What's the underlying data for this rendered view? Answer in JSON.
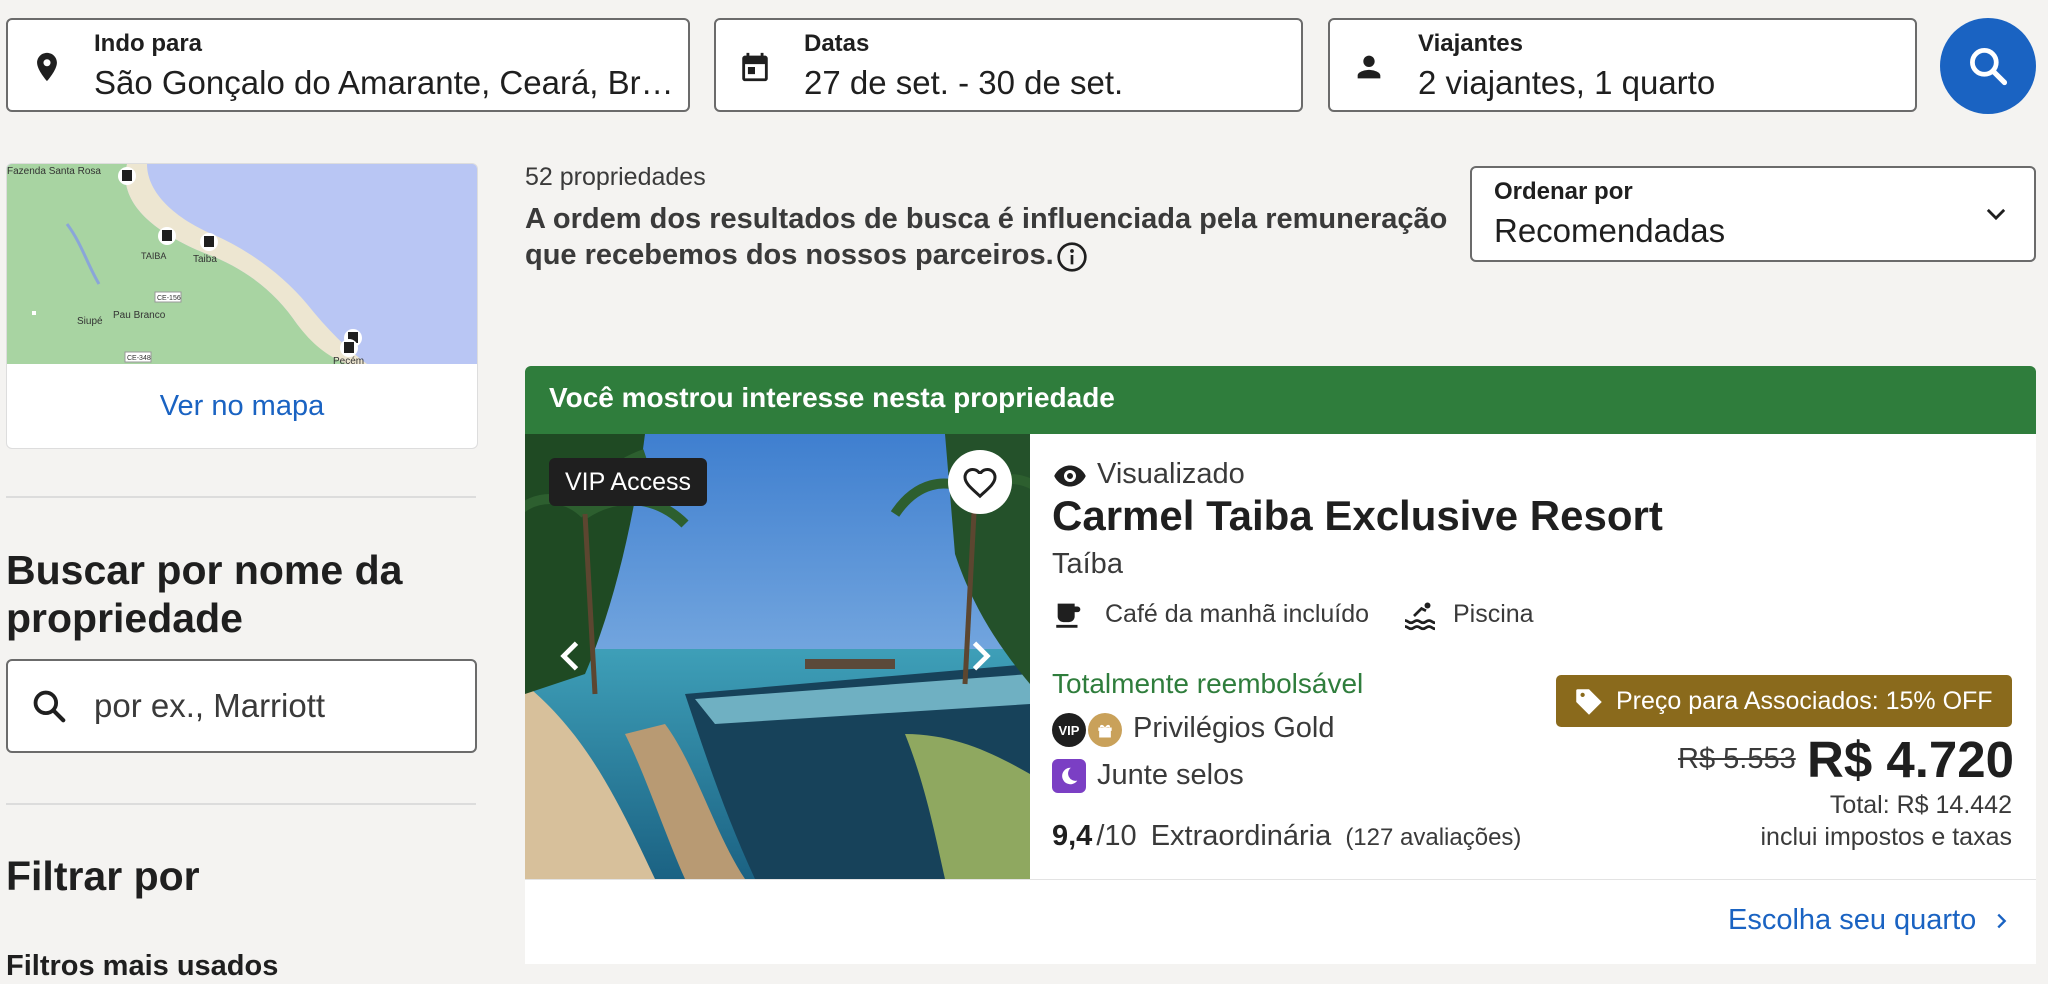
{
  "search": {
    "destination": {
      "label": "Indo para",
      "value": "São Gonçalo do Amarante, Ceará, Bra..."
    },
    "dates": {
      "label": "Datas",
      "value": "27 de set. - 30 de set."
    },
    "travelers": {
      "label": "Viajantes",
      "value": "2 viajantes, 1 quarto"
    }
  },
  "map": {
    "link": "Ver no mapa",
    "places": [
      "Fazenda Santa Rosa",
      "TAIBA",
      "Taiba",
      "Siupé",
      "Pau Branco",
      "CE-156",
      "CE-348",
      "Pecém"
    ]
  },
  "sidebar": {
    "search_heading": "Buscar por nome da propriedade",
    "name_placeholder": "por ex., Marriott",
    "filter_heading": "Filtrar por",
    "popular_filters": "Filtros mais usados"
  },
  "results": {
    "count": "52 propriedades",
    "notice_line1": "A ordem dos resultados de busca é influenciada pela remuneração",
    "notice_line2": "que recebemos dos nossos parceiros.",
    "sort": {
      "label": "Ordenar por",
      "value": "Recomendadas"
    }
  },
  "property": {
    "banner": "Você mostrou interesse nesta propriedade",
    "vip_badge": "VIP Access",
    "viewed": "Visualizado",
    "name": "Carmel Taiba Exclusive Resort",
    "location": "Taíba",
    "amenities": [
      "Café da manhã incluído",
      "Piscina"
    ],
    "refundable": "Totalmente reembolsável",
    "vip_mini": "VIP",
    "privileges": "Privilégios Gold",
    "stamps": "Junte selos",
    "rating": "9,4",
    "rating_scale": "/10",
    "rating_label": "Extraordinária",
    "reviews": "(127 avaliações)",
    "deal": "Preço para Associados: 15% OFF",
    "old_price": "R$ 5.553",
    "price": "R$ 4.720",
    "total": "Total: R$ 14.442",
    "taxes": "inclui impostos e taxas",
    "cta": "Escolha seu quarto"
  },
  "colors": {
    "accent": "#1a63c2",
    "banner_green": "#2f7d3c",
    "refund_green": "#2f7d3c",
    "deal_gold": "#8a6a1c",
    "stamps_purple": "#7b3fc4"
  }
}
